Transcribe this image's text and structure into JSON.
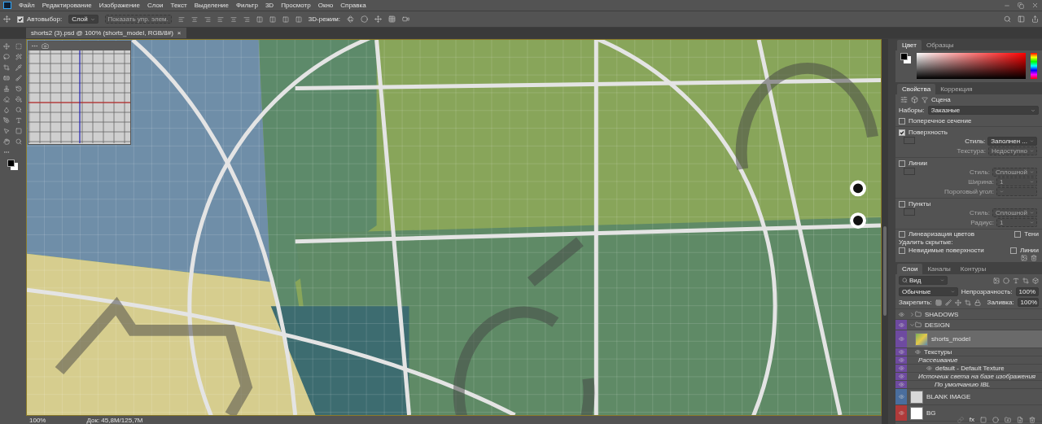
{
  "menu_bar": {
    "items": [
      "Файл",
      "Редактирование",
      "Изображение",
      "Слои",
      "Текст",
      "Выделение",
      "Фильтр",
      "3D",
      "Просмотр",
      "Окно",
      "Справка"
    ]
  },
  "options_bar": {
    "auto_select": {
      "label": "Автовыбор:",
      "checked": true
    },
    "target": "Слой",
    "show_controls": {
      "label": "Показать упр. элем.",
      "disabled": true
    },
    "mode_label": "3D-режим:"
  },
  "document_tab": {
    "title": "shorts2 (3).psd @ 100% (shorts_model, RGB/8#)",
    "close": "×"
  },
  "status_bar": {
    "zoom": "100%",
    "doc": "Док: 45,8M/125,7M"
  },
  "color_panel": {
    "tabs": [
      {
        "label": "Цвет",
        "selected": true
      },
      {
        "label": "Образцы",
        "selected": false
      }
    ]
  },
  "properties_panel": {
    "tabs": [
      {
        "label": "Свойства",
        "selected": true
      },
      {
        "label": "Коррекция",
        "selected": false
      }
    ],
    "section": "Сцена",
    "preset_label": "Наборы:",
    "preset": "Заказные",
    "options": [
      {
        "kind": "check",
        "label": "Поперечное сечение",
        "checked": false
      },
      {
        "kind": "style",
        "label": "Поверхность",
        "checked": true,
        "fields": [
          {
            "label": "Стиль:",
            "value": "Заполнен ...",
            "disabled": false
          },
          {
            "label": "Текстура:",
            "value": "Недоступно",
            "disabled": true
          }
        ]
      },
      {
        "kind": "style",
        "label": "Линии",
        "checked": false,
        "fields": [
          {
            "label": "Стиль:",
            "value": "Сплошной",
            "disabled": true
          },
          {
            "label": "Ширина:",
            "value": "1",
            "disabled": true
          },
          {
            "label": "Пороговый угол:",
            "disabled": true
          }
        ]
      },
      {
        "kind": "style",
        "label": "Пункты",
        "checked": false,
        "fields": [
          {
            "label": "Стиль:",
            "value": "Сплошной",
            "disabled": true
          },
          {
            "label": "Радиус:",
            "value": "1",
            "disabled": true
          }
        ]
      }
    ],
    "render_options": [
      {
        "label": "Линеаризация цветов",
        "checked": false
      },
      {
        "label": "Тени",
        "checked": false
      }
    ],
    "hide_label": "Удалить скрытые:",
    "hide_options": [
      {
        "label": "Невидимые поверхности",
        "checked": false
      },
      {
        "label": "Линии",
        "checked": false
      }
    ]
  },
  "layers_panel": {
    "tabs": [
      {
        "label": "Слои",
        "selected": true
      },
      {
        "label": "Каналы",
        "selected": false
      },
      {
        "label": "Контуры",
        "selected": false
      }
    ],
    "filter": "Вид",
    "blend_mode": "Обычные",
    "opacity_label": "Непрозрачность:",
    "opacity": "100%",
    "lock_label": "Закрепить:",
    "fill_label": "Заливка:",
    "fill": "100%",
    "fx_label": "fx",
    "layers": [
      {
        "kind": "group",
        "name": "SHADOWS",
        "expanded": false,
        "selected": false
      },
      {
        "kind": "group",
        "name": "DESIGN",
        "expanded": true,
        "selected": false,
        "color": "#6e4aa0",
        "children": [
          {
            "kind": "model",
            "name": "shorts_model",
            "selected": true,
            "children": [
              {
                "kind": "effect",
                "name": "Текстуры"
              },
              {
                "kind": "note",
                "name": "Рассеивание"
              },
              {
                "kind": "texture",
                "name": "default - Default Texture"
              },
              {
                "kind": "note",
                "name": "Источник света на базе изображения"
              },
              {
                "kind": "sub",
                "name": "По умолчанию IBL"
              }
            ]
          }
        ]
      },
      {
        "kind": "image",
        "name": "BLANK IMAGE",
        "selected": false,
        "color": "#4a6e9e"
      },
      {
        "kind": "fill",
        "name": "BG",
        "selected": false,
        "color": "#b03a3a"
      }
    ]
  }
}
